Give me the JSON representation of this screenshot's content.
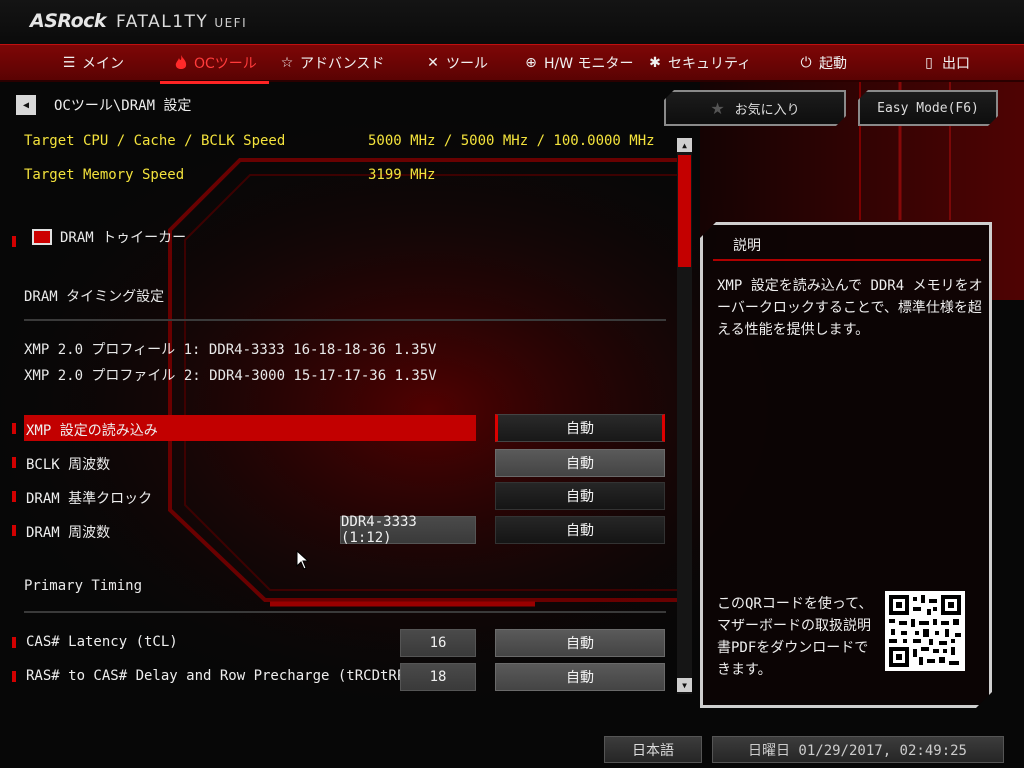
{
  "logo": {
    "brand": "ASRock",
    "series": "FATAL1TY",
    "suffix": "UEFI"
  },
  "nav": [
    {
      "label": "メイン",
      "icon": "list-icon"
    },
    {
      "label": "OCツール",
      "icon": "flame-icon",
      "active": true
    },
    {
      "label": "アドバンスド",
      "icon": "star-outline-icon"
    },
    {
      "label": "ツール",
      "icon": "tools-icon"
    },
    {
      "label": "H/W モニター",
      "icon": "crosshair-icon"
    },
    {
      "label": "セキュリティ",
      "icon": "shield-icon"
    },
    {
      "label": "起動",
      "icon": "power-icon"
    },
    {
      "label": "出口",
      "icon": "exit-door-icon"
    }
  ],
  "breadcrumb": "OCツール\\DRAM 設定",
  "target": {
    "cpu_label": "Target CPU / Cache / BCLK Speed",
    "cpu_value": "5000 MHz / 5000 MHz / 100.0000 MHz",
    "mem_label": "Target Memory Speed",
    "mem_value": "3199 MHz"
  },
  "tweaker_label": "DRAM トゥイーカー",
  "section_timing": "DRAM タイミング設定",
  "xmp": {
    "profile1": "XMP 2.0 プロフィール 1: DDR4-3333 16-18-18-36 1.35V",
    "profile2": "XMP 2.0 プロファイル 2: DDR4-3000 15-17-17-36 1.35V"
  },
  "settings": [
    {
      "label": "XMP 設定の読み込み",
      "value": "自動"
    },
    {
      "label": "BCLK 周波数",
      "value": "自動"
    },
    {
      "label": "DRAM 基準クロック",
      "value": "自動"
    },
    {
      "label": "DRAM 周波数",
      "current": "DDR4-3333 (1:12)",
      "value": "自動"
    }
  ],
  "primary_timing_label": "Primary Timing",
  "timings": [
    {
      "label": "CAS# Latency (tCL)",
      "current": "16",
      "value": "自動"
    },
    {
      "label": "RAS# to CAS# Delay and Row Precharge (tRCDtRP)",
      "current": "18",
      "value": "自動"
    }
  ],
  "favorites_label": "お気に入り",
  "easy_mode_label": "Easy Mode(F6)",
  "description": {
    "title": "説明",
    "body": "XMP 設定を読み込んで DDR4 メモリをオーバークロックすることで、標準仕様を超える性能を提供します。",
    "qr_text": "このQRコードを使って、マザーボードの取扱説明書PDFをダウンロードできます。"
  },
  "footer": {
    "language": "日本語",
    "datetime": "日曜日 01/29/2017, 02:49:25"
  },
  "colors": {
    "accent_red": "#c20000",
    "highlight_yellow": "#f3e23c",
    "text": "#e8e8e8"
  }
}
